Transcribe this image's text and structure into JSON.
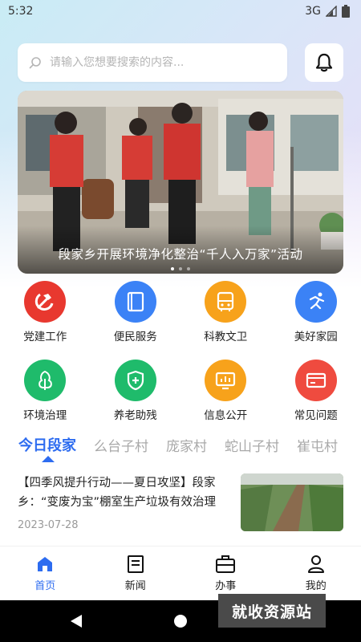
{
  "status_bar": {
    "time": "5:32",
    "network": "3G"
  },
  "search": {
    "placeholder": "请输入您想要搜索的内容..."
  },
  "banner": {
    "title": "段家乡开展环境净化整治“千人入万家”活动"
  },
  "grid": [
    {
      "label": "党建工作",
      "color": "#e8382f",
      "icon": "hammer-sickle-icon"
    },
    {
      "label": "便民服务",
      "color": "#3b82f6",
      "icon": "book-icon"
    },
    {
      "label": "科教文卫",
      "color": "#f7a21b",
      "icon": "bus-icon"
    },
    {
      "label": "美好家园",
      "color": "#3b82f6",
      "icon": "running-icon"
    },
    {
      "label": "环境治理",
      "color": "#1fbb6b",
      "icon": "tree-icon"
    },
    {
      "label": "养老助残",
      "color": "#1fbb6b",
      "icon": "shield-plus-icon"
    },
    {
      "label": "信息公开",
      "color": "#f7a21b",
      "icon": "monitor-chart-icon"
    },
    {
      "label": "常见问题",
      "color": "#ef4b3f",
      "icon": "card-icon"
    }
  ],
  "tabs": [
    "今日段家",
    "么台子村",
    "庞家村",
    "蛇山子村",
    "崔屯村"
  ],
  "active_tab": 0,
  "accent_color": "#2d6cf0",
  "news": {
    "title": "【四季风提升行动——夏日攻坚】段家乡：“变废为宝”棚室生产垃圾有效治理",
    "date": "2023-07-28"
  },
  "bottom_nav": [
    {
      "label": "首页",
      "icon": "home-icon",
      "active": true
    },
    {
      "label": "新闻",
      "icon": "news-icon",
      "active": false
    },
    {
      "label": "办事",
      "icon": "briefcase-icon",
      "active": false
    },
    {
      "label": "我的",
      "icon": "user-icon",
      "active": false
    }
  ],
  "watermark": "就收资源站"
}
